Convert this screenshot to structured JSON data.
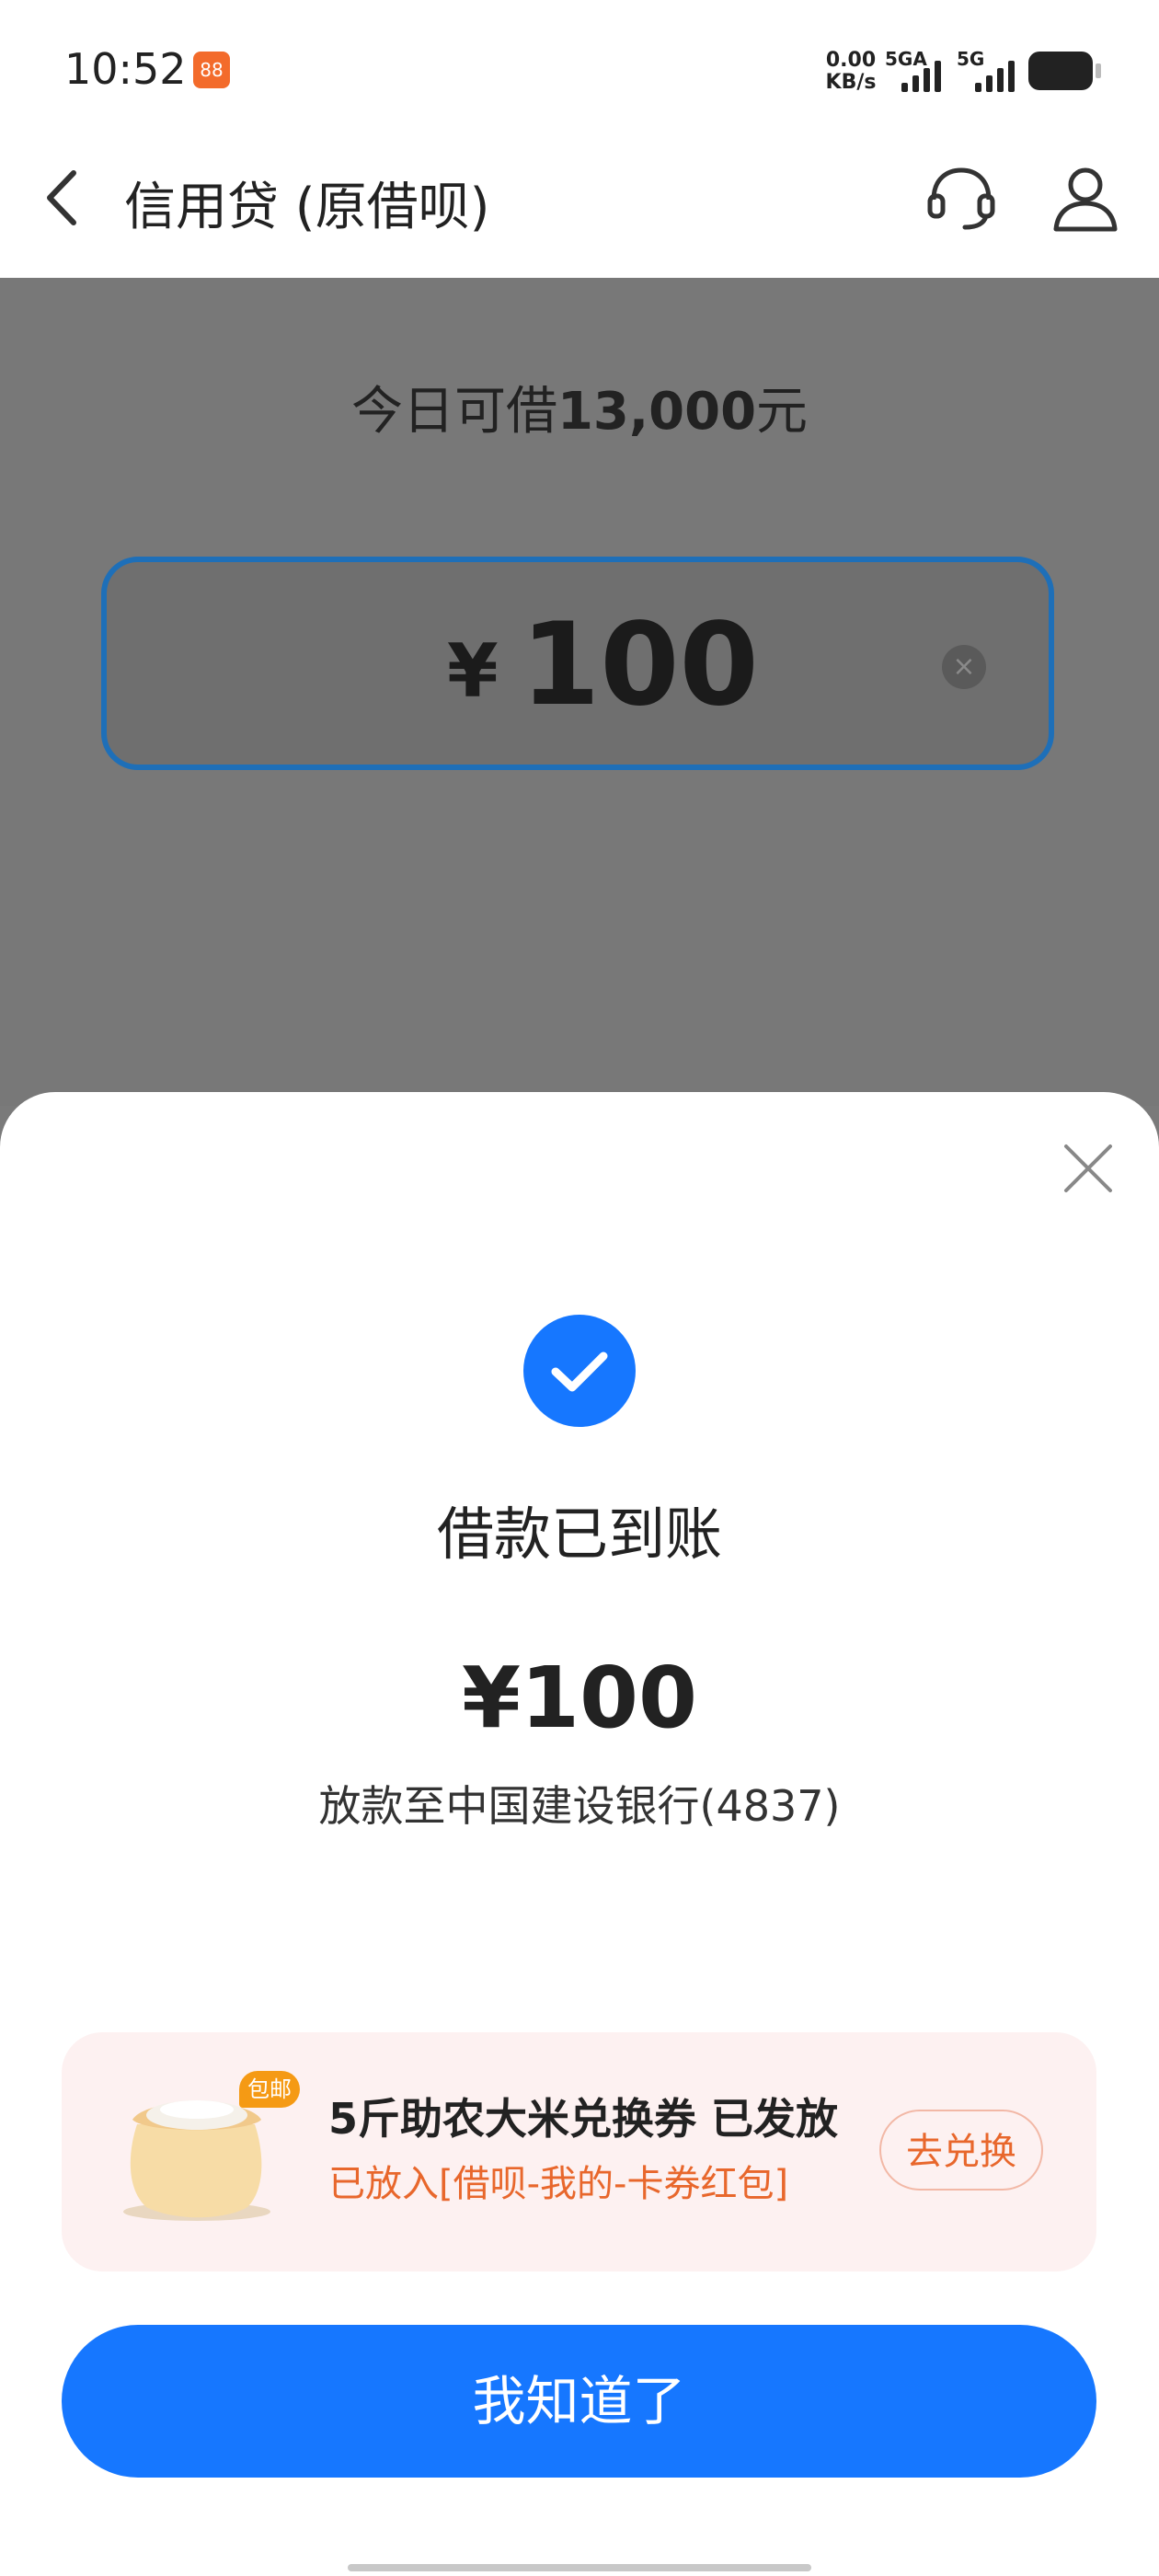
{
  "status_bar": {
    "time": "10:52",
    "app_badge": "88",
    "net_speed_value": "0.00",
    "net_speed_unit": "KB/s",
    "signal1_label": "5GA",
    "signal2_label": "5G"
  },
  "header": {
    "title": "信用贷 (原借呗)",
    "icons": [
      "back-icon",
      "customer-service-icon",
      "user-icon"
    ]
  },
  "background": {
    "available_prefix": "今日可借",
    "available_amount": "13,000",
    "available_suffix": "元",
    "currency": "¥",
    "input_value": "100"
  },
  "sheet": {
    "title": "借款已到账",
    "amount": "¥100",
    "destination": "放款至中国建设银行(4837)",
    "promo": {
      "badge": "包邮",
      "title": "5斤助农大米兑换券 已发放",
      "subtitle": "已放入[借呗-我的-卡券红包]",
      "button": "去兑换"
    },
    "confirm_button": "我知道了"
  },
  "colors": {
    "primary": "#1677ff",
    "promo_text": "#e8672c",
    "promo_bg": "#fdf1f1",
    "overlay": "#787878"
  }
}
